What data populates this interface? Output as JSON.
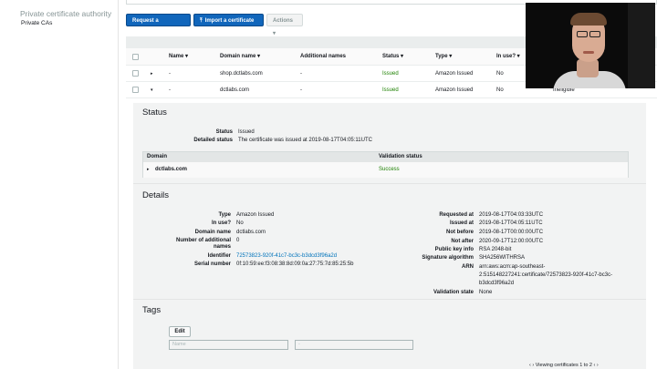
{
  "sidebar": {
    "title": "Private certificate authority",
    "items": [
      {
        "label": "Private CAs"
      }
    ]
  },
  "toolbar": {
    "request_label": "Request a certificate",
    "import_label": "Import a certificate",
    "actions_label": "Actions ▾"
  },
  "table": {
    "columns": [
      "Name ▾",
      "Domain name ▾",
      "Additional names",
      "Status ▾",
      "Type ▾",
      "In use? ▾"
    ],
    "rows": [
      {
        "expander": "▸",
        "name": "-",
        "domain": "shop.dctlabs.com",
        "additional": "-",
        "status": "Issued",
        "type": "Amazon Issued",
        "in_use": "No",
        "extra": ""
      },
      {
        "expander": "▾",
        "name": "-",
        "domain": "dctlabs.com",
        "additional": "-",
        "status": "Issued",
        "type": "Amazon Issued",
        "in_use": "No",
        "extra": "Ineligible"
      }
    ]
  },
  "status_section": {
    "heading": "Status",
    "status_label": "Status",
    "status_value": "Issued",
    "detailed_label": "Detailed status",
    "detailed_value": "The certificate was issued at 2019-08-17T04:05:11UTC",
    "domain_table": {
      "domain_header": "Domain",
      "validation_header": "Validation status",
      "expander": "▸",
      "domain": "dctlabs.com",
      "validation": "Success"
    }
  },
  "details_section": {
    "heading": "Details",
    "left": [
      {
        "label": "Type",
        "value": "Amazon Issued"
      },
      {
        "label": "In use?",
        "value": "No"
      },
      {
        "label": "Domain name",
        "value": "dctlabs.com"
      },
      {
        "label": "Number of additional names",
        "value": "0"
      },
      {
        "label": "Identifier",
        "value": "72573823-920f-41c7-bc3c-b3dcd3f96a2d"
      },
      {
        "label": "Serial number",
        "value": "0f:10:59:ee:f3:08:38:8d:09:0a:27:75:7d:85:25:5b"
      }
    ],
    "right": [
      {
        "label": "Requested at",
        "value": "2019-08-17T04:03:33UTC"
      },
      {
        "label": "Issued at",
        "value": "2019-08-17T04:05:11UTC"
      },
      {
        "label": "Not before",
        "value": "2019-08-17T00:00:00UTC"
      },
      {
        "label": "Not after",
        "value": "2020-09-17T12:00:00UTC"
      },
      {
        "label": "Public key info",
        "value": "RSA 2048-bit"
      },
      {
        "label": "Signature algorithm",
        "value": "SHA256WITHRSA"
      },
      {
        "label": "ARN",
        "value_lines": [
          "arn:aws:acm:ap-southeast-",
          "2:515148227241:certificate/72573823-920f-41c7-bc3c-",
          "b3dcd3f96a2d"
        ]
      },
      {
        "label": "Validation state",
        "value": "None"
      }
    ]
  },
  "tags_section": {
    "heading": "Tags",
    "edit_label": "Edit",
    "name_placeholder": "Name",
    "value_placeholder": "-"
  },
  "footer": {
    "pager_text": "‹  ›   Viewing certificates 1 to 2  ‹  ›"
  },
  "colors": {
    "primary_button": "#1166bb",
    "issued_green": "#1d8102",
    "link_blue": "#0073bb"
  }
}
